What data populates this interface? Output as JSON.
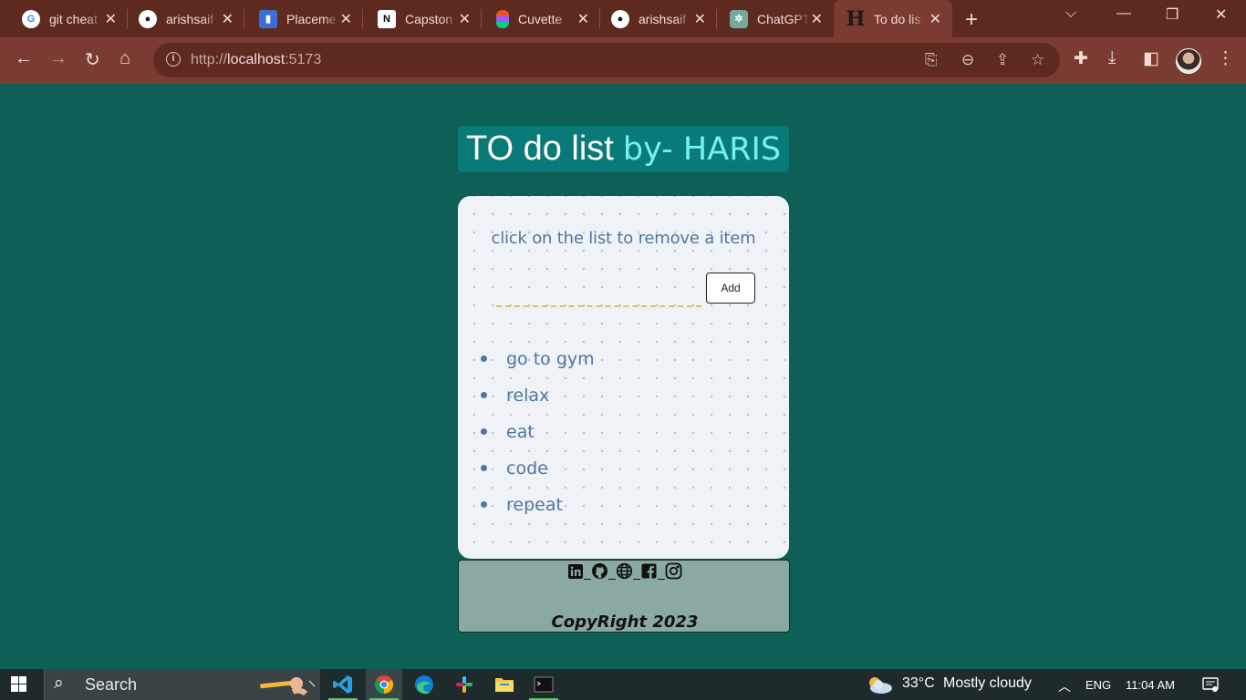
{
  "browser": {
    "tabs": [
      {
        "title": "git cheat",
        "icon": "google-icon"
      },
      {
        "title": "arishsaif",
        "icon": "github-icon"
      },
      {
        "title": "Placeme",
        "icon": "placement-icon"
      },
      {
        "title": "Capston",
        "icon": "notion-icon"
      },
      {
        "title": "Cuvette",
        "icon": "figma-icon"
      },
      {
        "title": "arishsaif",
        "icon": "github-icon"
      },
      {
        "title": "ChatGPT",
        "icon": "chatgpt-icon"
      },
      {
        "title": "To do lis",
        "icon": "h-icon",
        "active": true
      }
    ],
    "address": {
      "protocol": "http://",
      "host": "localhost",
      "port": ":5173"
    }
  },
  "page": {
    "title_main": "TO do list",
    "title_by": "by- HARIS",
    "hint": "click on the list to remove a item",
    "input_value": "",
    "add_label": "Add",
    "items": [
      "go to gym",
      "relax",
      "eat",
      "code",
      "repeat"
    ],
    "social_icons": [
      "linkedin-icon",
      "github-icon",
      "globe-icon",
      "facebook-icon",
      "instagram-icon"
    ],
    "copyright": "CopyRight 2023"
  },
  "taskbar": {
    "search_label": "Search",
    "weather_temp": "33°C",
    "weather_text": "Mostly cloudy",
    "language": "ENG",
    "time": "11:04 AM"
  },
  "colors": {
    "page_bg": "#0e5f56",
    "title_bg": "#0a7a79",
    "title_accent": "#6ff3ef",
    "item_text": "#4f75a0",
    "input_underline": "#f0ba6b",
    "footer_bg": "#8aa9a2",
    "browser_frame": "#7a3b30"
  }
}
